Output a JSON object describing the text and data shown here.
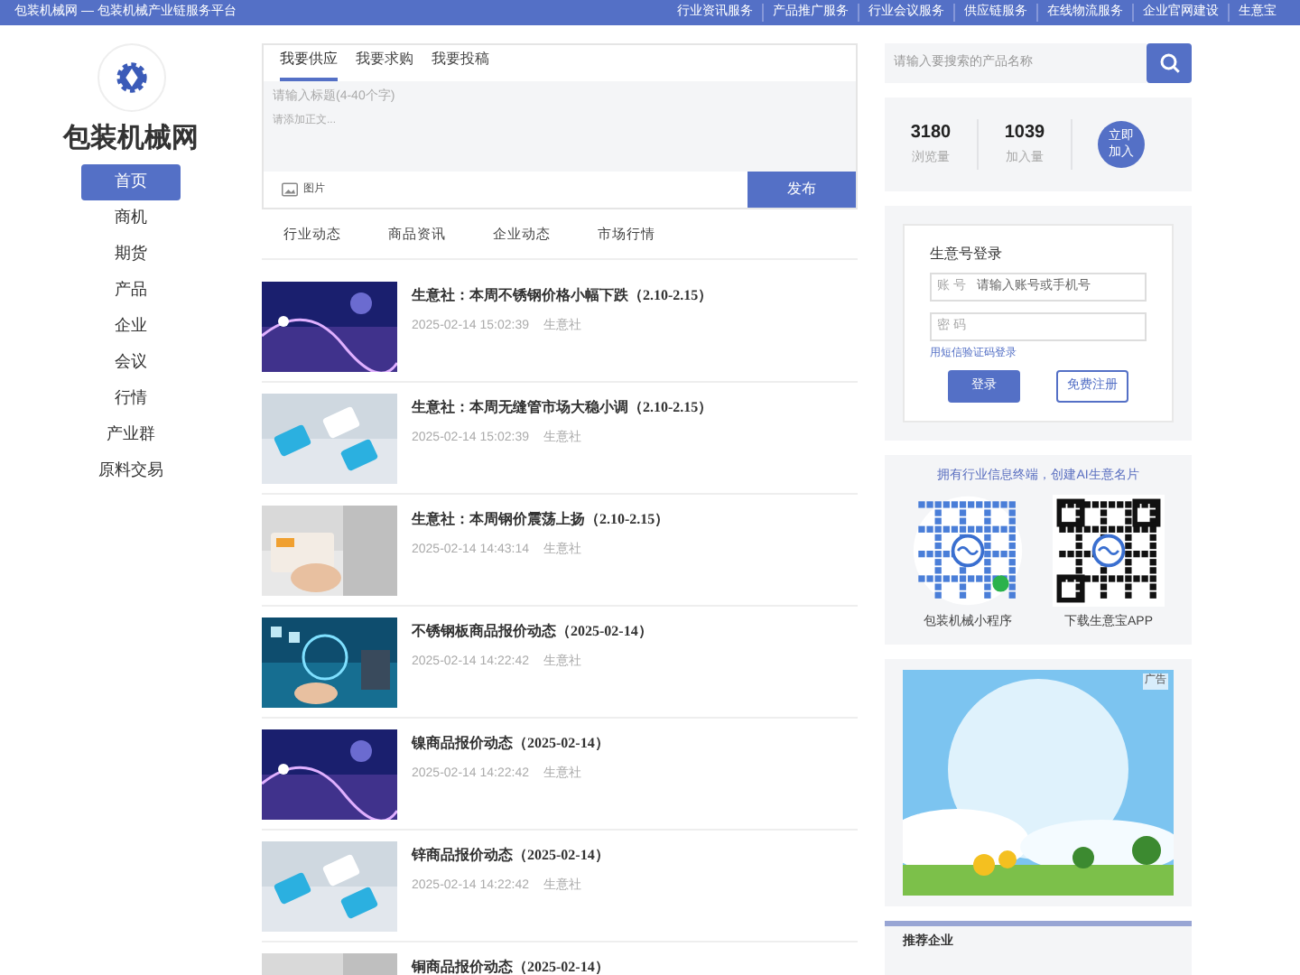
{
  "top_bar": {
    "site_title": "包装机械网 — 包装机械产业链服务平台",
    "links": [
      "行业资讯服务",
      "产品推广服务",
      "行业会议服务",
      "供应链服务",
      "在线物流服务",
      "企业官网建设",
      "生意宝"
    ]
  },
  "sidebar": {
    "logo_text": "包装机械网",
    "items": [
      {
        "label": "首页",
        "selected": true
      },
      {
        "label": "商机",
        "selected": false
      },
      {
        "label": "期货",
        "selected": false
      },
      {
        "label": "产品",
        "selected": false
      },
      {
        "label": "企业",
        "selected": false
      },
      {
        "label": "会议",
        "selected": false
      },
      {
        "label": "行情",
        "selected": false
      },
      {
        "label": "产业群",
        "selected": false
      },
      {
        "label": "原料交易",
        "selected": false
      }
    ]
  },
  "post_box": {
    "tabs": [
      {
        "label": "我要供应",
        "selected": true
      },
      {
        "label": "我要求购",
        "selected": false
      },
      {
        "label": "我要投稿",
        "selected": false
      }
    ],
    "title_placeholder": "请输入标题(4-40个字)",
    "body_placeholder": "请添加正文...",
    "image_label": "图片",
    "submit": "发布"
  },
  "news_tabs": [
    {
      "label": "行业动态",
      "selected": false
    },
    {
      "label": "商品资讯",
      "selected": false
    },
    {
      "label": "企业动态",
      "selected": false
    },
    {
      "label": "市场行情",
      "selected": false
    }
  ],
  "articles": [
    {
      "title": "生意社：本周不锈钢价格小幅下跌（2.10-2.15）",
      "time": "2025-02-14 15:02:39",
      "source": "生意社"
    },
    {
      "title": "生意社：本周无缝管市场大稳小调（2.10-2.15）",
      "time": "2025-02-14 15:02:39",
      "source": "生意社"
    },
    {
      "title": "生意社：本周钢价震荡上扬（2.10-2.15）",
      "time": "2025-02-14 14:43:14",
      "source": "生意社"
    },
    {
      "title": "不锈钢板商品报价动态（2025-02-14）",
      "time": "2025-02-14 14:22:42",
      "source": "生意社"
    },
    {
      "title": "镍商品报价动态（2025-02-14）",
      "time": "2025-02-14 14:22:42",
      "source": "生意社"
    },
    {
      "title": "锌商品报价动态（2025-02-14）",
      "time": "2025-02-14 14:22:42",
      "source": "生意社"
    },
    {
      "title": "铜商品报价动态（2025-02-14）"
    }
  ],
  "search": {
    "placeholder": "请输入要搜索的产品名称"
  },
  "stats": [
    {
      "value": "3180",
      "label": "浏览量"
    },
    {
      "value": "1039",
      "label": "加入量"
    }
  ],
  "join_button": "立即加入",
  "login": {
    "title": "生意号登录",
    "account_label": "账 号",
    "account_placeholder": "请输入账号或手机号",
    "password_label": "密 码",
    "sms_link": "用短信验证码登录",
    "login_button": "登录",
    "register_button": "免费注册"
  },
  "apps": {
    "heading": "拥有行业信息终端，创建AI生意名片",
    "items": [
      "包装机械小程序",
      "下载生意宝APP"
    ]
  },
  "ad": {
    "tag": "广告"
  },
  "recommend": {
    "title": "推荐企业"
  }
}
